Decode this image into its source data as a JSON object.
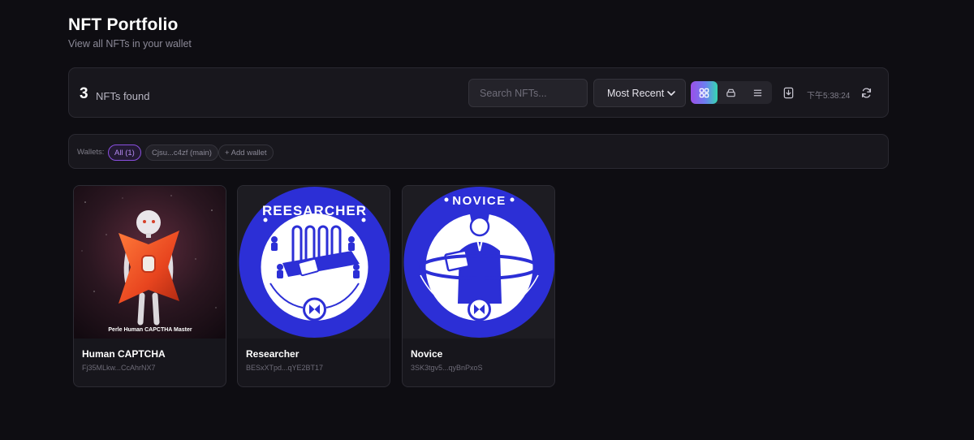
{
  "header": {
    "title": "NFT Portfolio",
    "subtitle": "View all NFTs in your wallet"
  },
  "toolbar": {
    "count": "3",
    "count_label": "NFTs found",
    "search_placeholder": "Search NFTs...",
    "sort_selected": "Most Recent",
    "views": [
      "grid-view-icon",
      "gallery-view-icon",
      "list-view-icon"
    ],
    "active_view": "grid",
    "export_icon": "download-icon",
    "last_updated": "下午5:38:24",
    "refresh_icon": "refresh-icon"
  },
  "wallets": {
    "label": "Wallets:",
    "chips": [
      "All (1)",
      "Cjsu...c4zf (main)",
      "+ Add wallet"
    ]
  },
  "nfts": [
    {
      "name": "Human CAPTCHA",
      "address": "Fj35MLkw...CcAhrNX7",
      "image_caption": "Perle Human CAPCTHA Master"
    },
    {
      "name": "Researcher",
      "address": "BESxXTpd...qYE2BT17",
      "image_caption": "REESARCHER"
    },
    {
      "name": "Novice",
      "address": "3SK3tgv5...qyBnPxoS",
      "image_caption": "NOVICE"
    }
  ],
  "colors": {
    "background": "#0e0d12",
    "panel": "#18171d",
    "accent_purple": "#9c4fe8",
    "accent_teal": "#35d8b0",
    "badge_blue": "#2c2fd6"
  }
}
